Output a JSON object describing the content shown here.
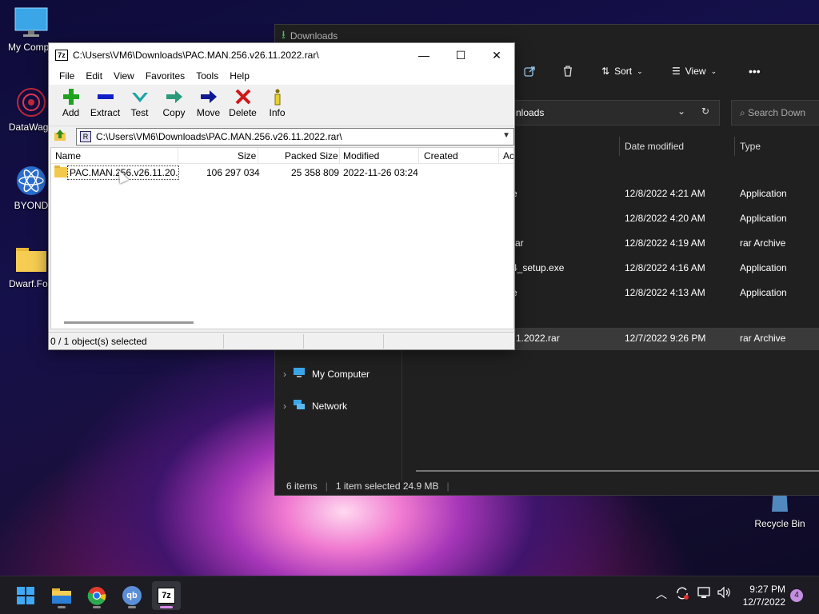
{
  "desktop": {
    "icons": [
      {
        "label": "My Compu"
      },
      {
        "label": "DataWago"
      },
      {
        "label": "BYOND"
      },
      {
        "label": "Dwarf.Fort"
      },
      {
        "label": "Recycle Bin"
      }
    ]
  },
  "explorer": {
    "title": "Downloads",
    "toolbar": {
      "sort": "Sort",
      "view": "View",
      "more": "•••"
    },
    "address_path": "nloads",
    "search_placeholder": "Search Down",
    "columns": {
      "date_modified": "Date modified",
      "type": "Type"
    },
    "rows": [
      {
        "name": "e",
        "date": "12/8/2022 4:21 AM",
        "type": "Application"
      },
      {
        "name": "",
        "date": "12/8/2022 4:20 AM",
        "type": "Application"
      },
      {
        "name": "rar",
        "date": "12/8/2022 4:19 AM",
        "type": "rar Archive"
      },
      {
        "name": "4_setup.exe",
        "date": "12/8/2022 4:16 AM",
        "type": "Application"
      },
      {
        "name": "e",
        "date": "12/8/2022 4:13 AM",
        "type": "Application"
      },
      {
        "name": "1.2022.rar",
        "date": "12/7/2022 9:26 PM",
        "type": "rar Archive"
      }
    ],
    "nav": [
      {
        "label": "My Computer"
      },
      {
        "label": "Network"
      }
    ],
    "status": {
      "items": "6 items",
      "selected": "1 item selected  24.9 MB"
    }
  },
  "sevenzip": {
    "logo": "7z",
    "title": "C:\\Users\\VM6\\Downloads\\PAC.MAN.256.v26.11.2022.rar\\",
    "menu": [
      "File",
      "Edit",
      "View",
      "Favorites",
      "Tools",
      "Help"
    ],
    "tools": [
      {
        "label": "Add",
        "icon": "plus-icon",
        "color": "#1fa31f"
      },
      {
        "label": "Extract",
        "icon": "minus-icon",
        "color": "#1020c8"
      },
      {
        "label": "Test",
        "icon": "check-icon",
        "color": "#1aa3a3"
      },
      {
        "label": "Copy",
        "icon": "copy-arrow-icon",
        "color": "#2a9a7a"
      },
      {
        "label": "Move",
        "icon": "move-arrow-icon",
        "color": "#101890"
      },
      {
        "label": "Delete",
        "icon": "x-icon",
        "color": "#d01818"
      },
      {
        "label": "Info",
        "icon": "info-icon",
        "color": "#807000"
      }
    ],
    "address": "C:\\Users\\VM6\\Downloads\\PAC.MAN.256.v26.11.2022.rar\\",
    "columns": [
      "Name",
      "Size",
      "Packed Size",
      "Modified",
      "Created",
      "Ac"
    ],
    "rows": [
      {
        "name": "PAC.MAN.256.v26.11.20...",
        "size": "106 297 034",
        "packed": "25 358 809",
        "modified": "2022-11-26 03:24",
        "created": ""
      }
    ],
    "status": "0 / 1 object(s) selected"
  },
  "taskbar": {
    "apps": [
      {
        "name": "start"
      },
      {
        "name": "file-explorer"
      },
      {
        "name": "chrome"
      },
      {
        "name": "qbittorrent",
        "label": "qb"
      },
      {
        "name": "7zip",
        "label": "7z"
      }
    ],
    "time": "9:27 PM",
    "date": "12/7/2022",
    "notifications": "4"
  }
}
